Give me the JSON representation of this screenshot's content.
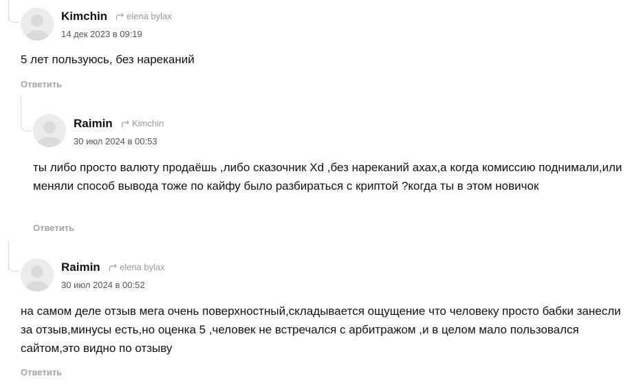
{
  "comments": [
    {
      "author": "Kimchin",
      "reply_to": "elena bylax",
      "date": "14 дек 2023 в 09:19",
      "text": "5 лет пользуюсь, без нареканий",
      "reply_label": "Ответить"
    },
    {
      "author": "Raimin",
      "reply_to": "Kimchin",
      "date": "30 июл 2024 в 00:53",
      "text": "ты либо просто валюту продаёшь ,либо сказочник Xd ,без нареканий ахах,а когда комиссию поднимали,или меняли способ вывода тоже по кайфу было разбираться с криптой ?когда ты в этом новичок",
      "reply_label": "Ответить"
    },
    {
      "author": "Raimin",
      "reply_to": "elena bylax",
      "date": "30 июл 2024 в 00:52",
      "text": "на самом деле отзыв мега очень поверхностный,складывается ощущение что человеку просто бабки занесли за отзыв,минусы есть,но оценка 5 ,человек не встречался с арбитражом ,и в целом мало пользовался сайтом,это видно по отзыву",
      "reply_label": "Ответить"
    }
  ]
}
